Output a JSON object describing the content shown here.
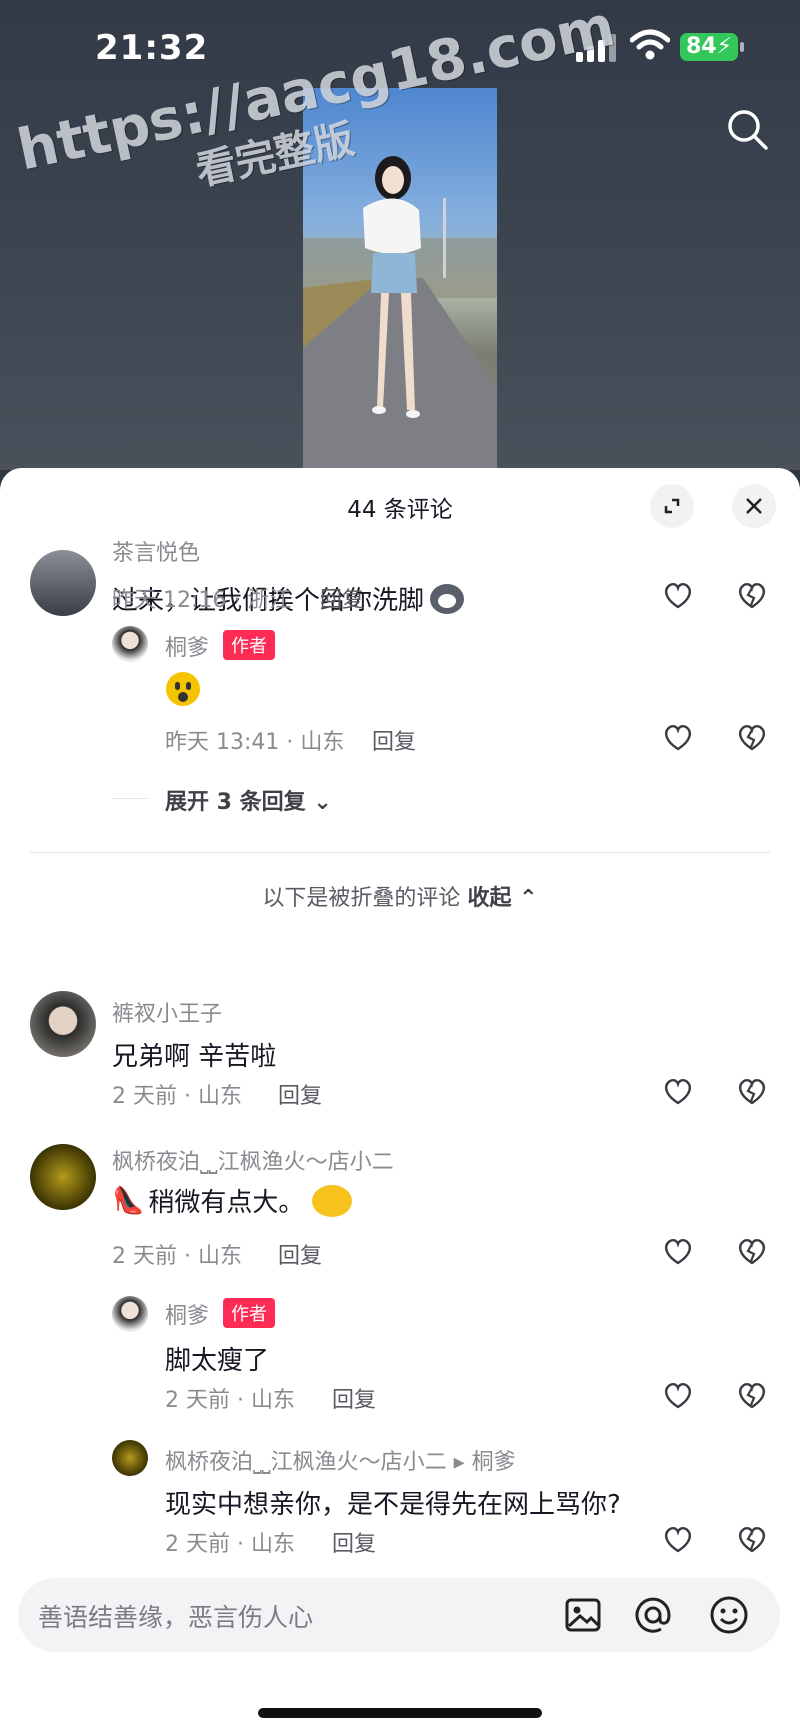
{
  "status_bar": {
    "time": "21:32",
    "battery": "84"
  },
  "watermark": {
    "line1": "https://aacg18.com",
    "line2": "看完整版"
  },
  "sheet": {
    "title": "44 条评论"
  },
  "comments": [
    {
      "user": "茶言悦色",
      "text": "过来，让我们挨个给你洗脚",
      "meta": "昨天 12:16 · 浙江",
      "reply": "回复"
    },
    {
      "user": "桐爹",
      "badge": "作者",
      "text": "",
      "meta": "昨天 13:41 · 山东",
      "reply": "回复"
    },
    {
      "expand": "展开 3 条回复"
    },
    {
      "folded_label": "以下是被折叠的评论",
      "collapse": "收起"
    },
    {
      "user": "裤衩小王子",
      "text": "兄弟啊 辛苦啦",
      "meta": "2 天前 · 山东",
      "reply": "回复"
    },
    {
      "user": "枫桥夜泊⎵⎵江枫渔火～店小二",
      "text": "稍微有点大。",
      "meta": "2 天前 · 山东",
      "reply": "回复"
    },
    {
      "user": "桐爹",
      "badge": "作者",
      "text": "脚太瘦了",
      "meta": "2 天前 · 山东",
      "reply": "回复"
    },
    {
      "user": "枫桥夜泊⎵⎵江枫渔火～店小二",
      "reply_to": "桐爹",
      "text": "现实中想亲你，是不是得先在网上骂你?",
      "meta": "2 天前 · 山东",
      "reply": "回复"
    }
  ],
  "input": {
    "placeholder": "善语结善缘，恶言伤人心"
  },
  "icons": [
    "search-icon",
    "expand-icon",
    "close-icon",
    "like-icon",
    "dislike-icon",
    "image-icon",
    "at-icon",
    "emoji-icon"
  ],
  "colors": {
    "accent": "#fe2c55",
    "battery": "#34c759"
  }
}
